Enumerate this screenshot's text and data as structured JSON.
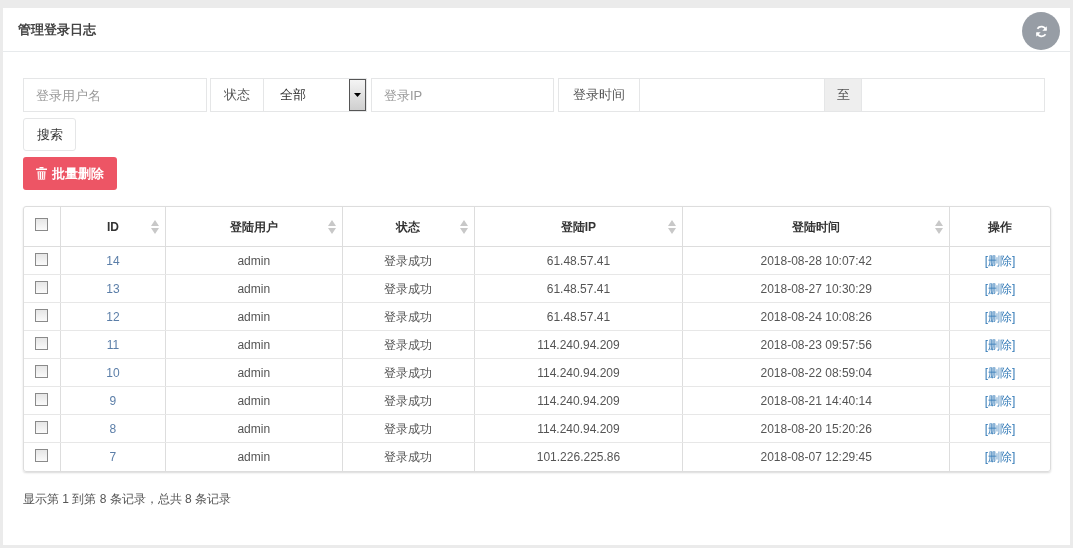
{
  "panel": {
    "title": "管理登录日志"
  },
  "filters": {
    "username": {
      "placeholder": "登录用户名"
    },
    "status": {
      "label": "状态",
      "value": "全部"
    },
    "ip": {
      "placeholder": "登录IP"
    },
    "time": {
      "label": "登录时间",
      "separator": "至"
    },
    "search_button": "搜索"
  },
  "batch_delete_button": "批量删除",
  "table": {
    "select_all": {
      "checked": false
    },
    "columns": [
      {
        "label": "ID",
        "sortable": true
      },
      {
        "label": "登陆用户",
        "sortable": true
      },
      {
        "label": "状态",
        "sortable": true
      },
      {
        "label": "登陆IP",
        "sortable": true
      },
      {
        "label": "登陆时间",
        "sortable": true
      },
      {
        "label": "操作",
        "sortable": false
      }
    ],
    "rows": [
      {
        "checked": false,
        "id": "14",
        "user": "admin",
        "status": "登录成功",
        "ip": "61.48.57.41",
        "time": "2018-08-28 10:07:42",
        "action": "[删除]"
      },
      {
        "checked": false,
        "id": "13",
        "user": "admin",
        "status": "登录成功",
        "ip": "61.48.57.41",
        "time": "2018-08-27 10:30:29",
        "action": "[删除]"
      },
      {
        "checked": false,
        "id": "12",
        "user": "admin",
        "status": "登录成功",
        "ip": "61.48.57.41",
        "time": "2018-08-24 10:08:26",
        "action": "[删除]"
      },
      {
        "checked": false,
        "id": "11",
        "user": "admin",
        "status": "登录成功",
        "ip": "114.240.94.209",
        "time": "2018-08-23 09:57:56",
        "action": "[删除]"
      },
      {
        "checked": false,
        "id": "10",
        "user": "admin",
        "status": "登录成功",
        "ip": "114.240.94.209",
        "time": "2018-08-22 08:59:04",
        "action": "[删除]"
      },
      {
        "checked": false,
        "id": "9",
        "user": "admin",
        "status": "登录成功",
        "ip": "114.240.94.209",
        "time": "2018-08-21 14:40:14",
        "action": "[删除]"
      },
      {
        "checked": false,
        "id": "8",
        "user": "admin",
        "status": "登录成功",
        "ip": "114.240.94.209",
        "time": "2018-08-20 15:20:26",
        "action": "[删除]"
      },
      {
        "checked": false,
        "id": "7",
        "user": "admin",
        "status": "登录成功",
        "ip": "101.226.225.86",
        "time": "2018-08-07 12:29:45",
        "action": "[删除]"
      }
    ]
  },
  "footer": "显示第 1 到第 8 条记录，总共 8 条记录"
}
